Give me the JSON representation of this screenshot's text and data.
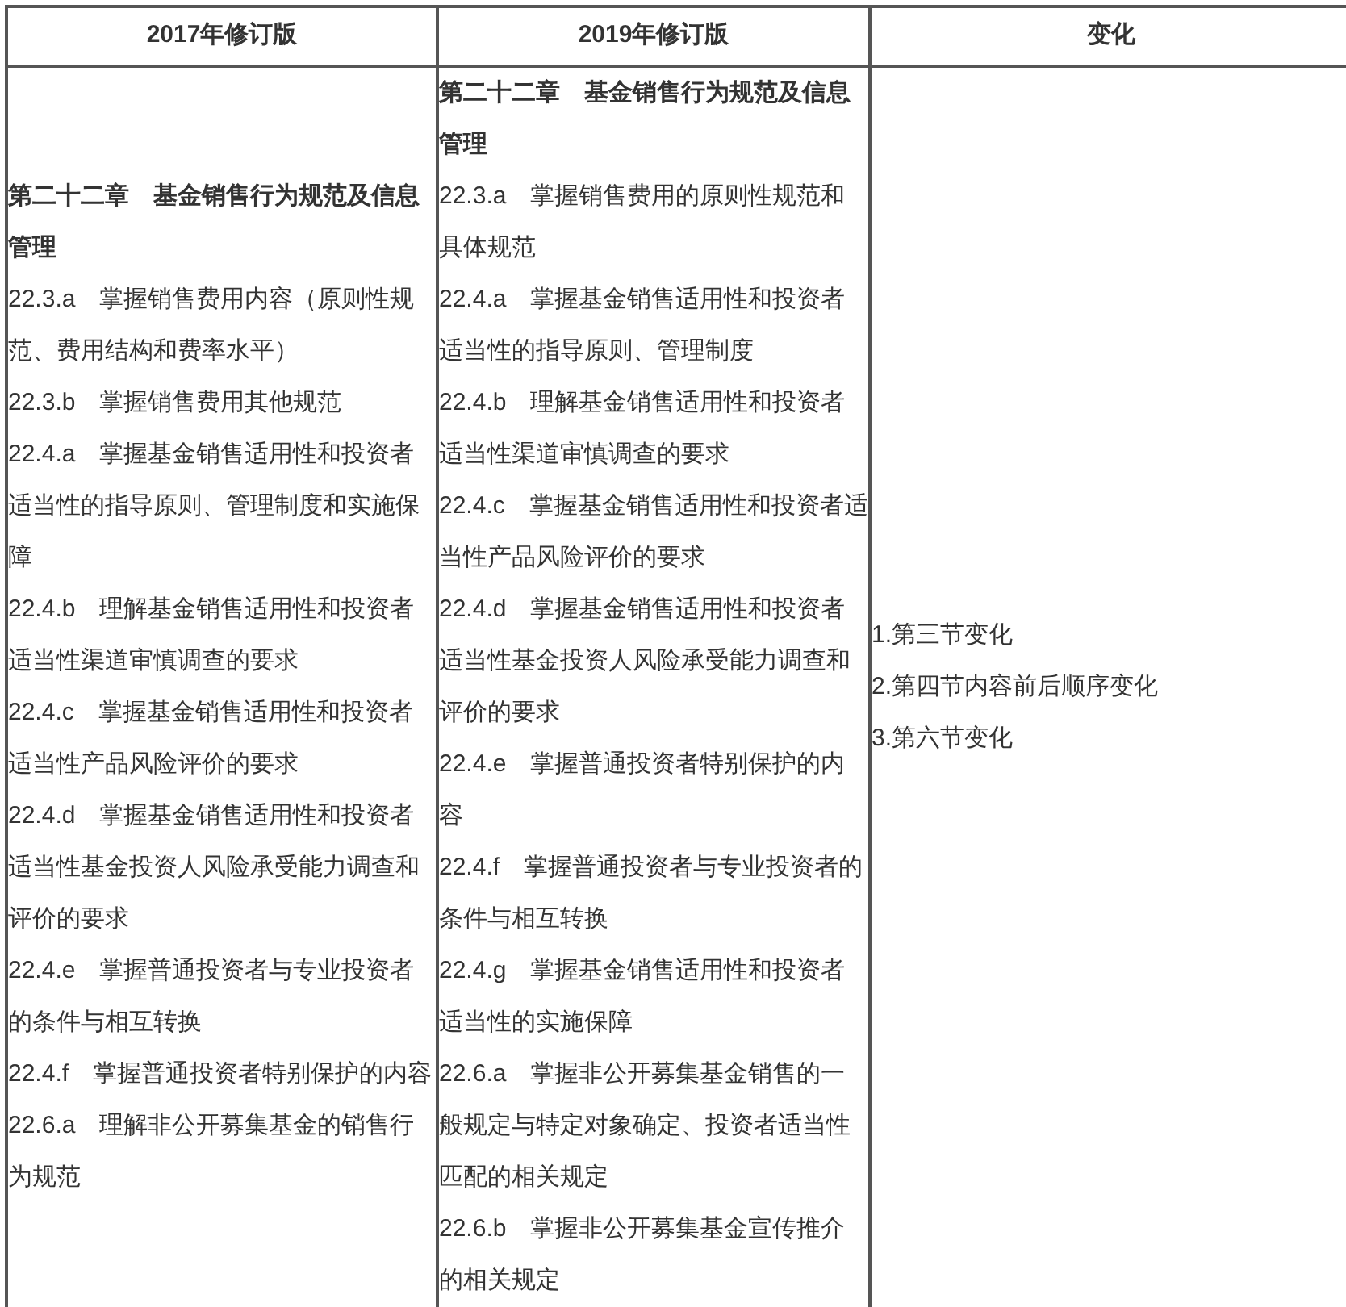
{
  "table": {
    "columns": [
      "2017年修订版",
      "2019年修订版",
      "变化"
    ],
    "rows": [
      {
        "cells": [
          {
            "heading": "第二十二章　基金销售行为规范及信息管理",
            "items": [
              "22.3.a　掌握销售费用内容（原则性规范、费用结构和费率水平）",
              "22.3.b　掌握销售费用其他规范",
              "22.4.a　掌握基金销售适用性和投资者适当性的指导原则、管理制度和实施保障",
              "22.4.b　理解基金销售适用性和投资者适当性渠道审慎调查的要求",
              "22.4.c　掌握基金销售适用性和投资者适当性产品风险评价的要求",
              "22.4.d　掌握基金销售适用性和投资者适当性基金投资人风险承受能力调查和评价的要求",
              "22.4.e　掌握普通投资者与专业投资者的条件与相互转换",
              "22.4.f　掌握普通投资者特别保护的内容",
              "22.6.a　理解非公开募集基金的销售行为规范"
            ]
          },
          {
            "heading": "第二十二章　基金销售行为规范及信息管理",
            "items": [
              "22.3.a　掌握销售费用的原则性规范和具体规范",
              "22.4.a　掌握基金销售适用性和投资者适当性的指导原则、管理制度",
              "22.4.b　理解基金销售适用性和投资者适当性渠道审慎调查的要求",
              "22.4.c　掌握基金销售适用性和投资者适当性产品风险评价的要求",
              "22.4.d　掌握基金销售适用性和投资者适当性基金投资人风险承受能力调查和评价的要求",
              "22.4.e　掌握普通投资者特别保护的内容",
              "22.4.f　掌握普通投资者与专业投资者的条件与相互转换",
              "22.4.g　掌握基金销售适用性和投资者适当性的实施保障",
              "22.6.a　掌握非公开募集基金销售的一般规定与特定对象确定、投资者适当性匹配的相关规定",
              "22.6.b　掌握非公开募集基金宣传推介的相关规定"
            ]
          },
          {
            "items": [
              "1.第三节变化",
              "2.第四节内容前后顺序变化",
              "3.第六节变化"
            ]
          }
        ]
      }
    ]
  }
}
